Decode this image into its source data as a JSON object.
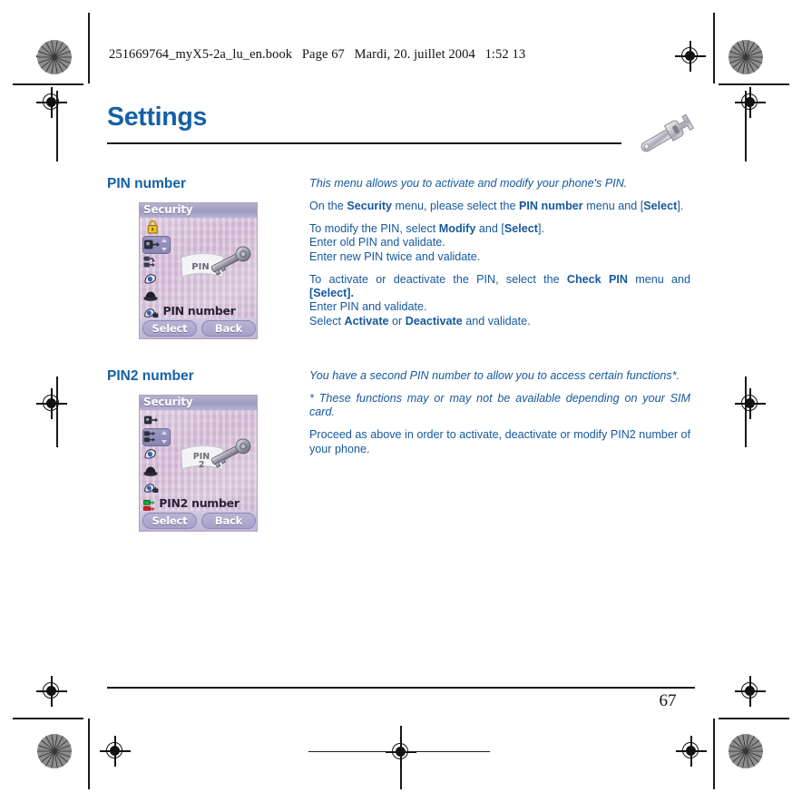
{
  "print_header": {
    "filename": "251669764_myX5-2a_lu_en.book",
    "page_label": "Page 67",
    "date": "Mardi, 20. juillet 2004",
    "time": "1:52 13"
  },
  "document": {
    "title": "Settings",
    "header_icon": "wrench-icon",
    "page_number": "67",
    "accent_color": "#1560a8",
    "body_color": "#15589e"
  },
  "sections": [
    {
      "heading": "PIN number",
      "screenshot": {
        "titlebar": "Security",
        "caption": "PIN number",
        "key_label": "PIN",
        "key_label_2": "",
        "softkey_left": "Select",
        "softkey_right": "Back",
        "selected_index": 1,
        "icons": [
          "padlock-icon",
          "pin-code-icon",
          "pin2-code-icon",
          "call-barring-icon",
          "privacy-icon",
          "operator-lock-icon"
        ]
      },
      "paragraphs": [
        {
          "style": "italic",
          "runs": [
            {
              "text": "This menu allows you to activate and modify your phone's PIN.",
              "bold": false
            }
          ]
        },
        {
          "style": "normal",
          "runs": [
            {
              "text": "On the ",
              "bold": false
            },
            {
              "text": "Security",
              "bold": true
            },
            {
              "text": " menu, please select the ",
              "bold": false
            },
            {
              "text": "PIN number",
              "bold": true
            },
            {
              "text": " menu and [",
              "bold": false
            },
            {
              "text": "Select",
              "bold": true
            },
            {
              "text": "].",
              "bold": false
            }
          ]
        },
        {
          "style": "normal",
          "runs": [
            {
              "text": "To modify the PIN, select ",
              "bold": false
            },
            {
              "text": "Modify",
              "bold": true
            },
            {
              "text": " and [",
              "bold": false
            },
            {
              "text": "Select",
              "bold": true
            },
            {
              "text": "].",
              "bold": false
            },
            {
              "text": "\n",
              "bold": false
            },
            {
              "text": "Enter old PIN and validate.",
              "bold": false
            },
            {
              "text": "\n",
              "bold": false
            },
            {
              "text": "Enter new PIN twice and validate.",
              "bold": false
            }
          ]
        },
        {
          "style": "normal",
          "runs": [
            {
              "text": "To activate or deactivate the PIN, select the ",
              "bold": false
            },
            {
              "text": "Check PIN",
              "bold": true
            },
            {
              "text": " menu and ",
              "bold": false
            },
            {
              "text": "[Select].",
              "bold": true
            },
            {
              "text": "\n",
              "bold": false
            },
            {
              "text": "Enter PIN and validate.",
              "bold": false
            },
            {
              "text": "\n",
              "bold": false
            },
            {
              "text": "Select ",
              "bold": false
            },
            {
              "text": "Activate",
              "bold": true
            },
            {
              "text": " or ",
              "bold": false
            },
            {
              "text": "Deactivate",
              "bold": true
            },
            {
              "text": " and validate.",
              "bold": false
            }
          ]
        }
      ]
    },
    {
      "heading": "PIN2 number",
      "screenshot": {
        "titlebar": "Security",
        "caption": "PIN2 number",
        "key_label": "PIN",
        "key_label_2": "2",
        "softkey_left": "Select",
        "softkey_right": "Back",
        "selected_index": 1,
        "icons": [
          "pin-code-icon",
          "pin2-code-icon",
          "call-barring-icon",
          "privacy-icon",
          "operator-lock-icon",
          "battery-icon"
        ]
      },
      "paragraphs": [
        {
          "style": "italic",
          "runs": [
            {
              "text": "You have a second PIN number to allow you to access certain functions*.",
              "bold": false
            }
          ]
        },
        {
          "style": "italic",
          "runs": [
            {
              "text": "* These functions may or may not be available depending on your SIM card.",
              "bold": false
            }
          ]
        },
        {
          "style": "normal",
          "runs": [
            {
              "text": "Proceed as above in order to activate, deactivate or modify PIN2 number of your phone.",
              "bold": false
            }
          ]
        }
      ]
    }
  ]
}
